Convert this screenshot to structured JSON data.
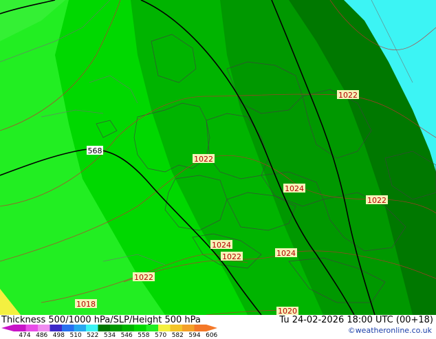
{
  "map": {
    "pressure_labels": [
      "1022",
      "1022",
      "1024",
      "1022",
      "1024",
      "1024",
      "1022",
      "1022",
      "1018",
      "1020"
    ],
    "height_label": "568",
    "colors": {
      "pale_green": "#22ee22",
      "green": "#00d800",
      "mid_green": "#00b400",
      "dark_green": "#009800",
      "darker_green": "#007800",
      "cyan": "#3cf4f4",
      "yellow": "#f4f040",
      "isobar": "#c03030",
      "height_contour": "#000000",
      "borders": "#404040"
    }
  },
  "footer": {
    "title": "Thickness 500/1000 hPa/SLP/Height 500 hPa",
    "datetime": "Tu 24-02-2026 18:00 UTC (00+18)",
    "credit": "©weatheronline.co.uk",
    "scale_colors": [
      "#c814c8",
      "#e84ce8",
      "#f08cf0",
      "#3c28c8",
      "#2870f0",
      "#28a8f0",
      "#3cf4f4",
      "#007800",
      "#009800",
      "#00b400",
      "#00d800",
      "#22ee22",
      "#f4f040",
      "#f4c428",
      "#f4a028",
      "#f47828"
    ],
    "scale_ticks": [
      "474",
      "486",
      "498",
      "510",
      "522",
      "534",
      "546",
      "558",
      "570",
      "582",
      "594",
      "606"
    ]
  }
}
